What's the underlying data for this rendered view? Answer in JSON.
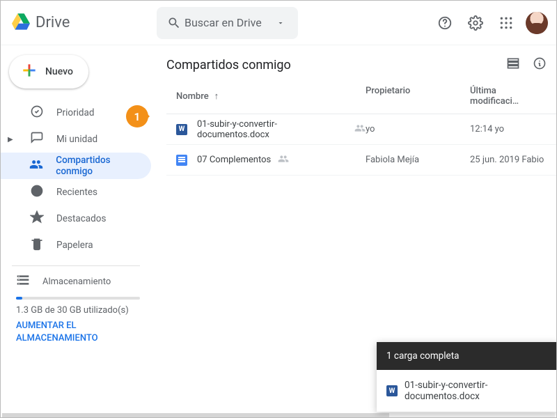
{
  "header": {
    "app_name": "Drive",
    "search_placeholder": "Buscar en Drive"
  },
  "sidebar": {
    "new_label": "Nuevo",
    "items": [
      {
        "label": "Prioridad"
      },
      {
        "label": "Mi unidad"
      },
      {
        "label": "Compartidos conmigo"
      },
      {
        "label": "Recientes"
      },
      {
        "label": "Destacados"
      },
      {
        "label": "Papelera"
      }
    ],
    "storage": {
      "title": "Almacenamiento",
      "usage_text": "1.3 GB de 30 GB utilizado(s)",
      "upsell": "AUMENTAR EL ALMACENAMIENTO"
    }
  },
  "main": {
    "title": "Compartidos conmigo",
    "columns": {
      "name": "Nombre",
      "owner": "Propietario",
      "modified": "Última modificaci…"
    },
    "rows": [
      {
        "name": "01-subir-y-convertir-documentos.docx",
        "owner": "yo",
        "modified": "12:14 yo",
        "type": "word"
      },
      {
        "name": "07 Complementos",
        "owner": "Fabiola Mejía",
        "modified": "25 jun. 2019 Fabio",
        "type": "gdoc"
      }
    ]
  },
  "toast": {
    "title": "1 carga completa",
    "file": "01-subir-y-convertir-documentos.docx"
  },
  "annotation": {
    "num": "1"
  }
}
